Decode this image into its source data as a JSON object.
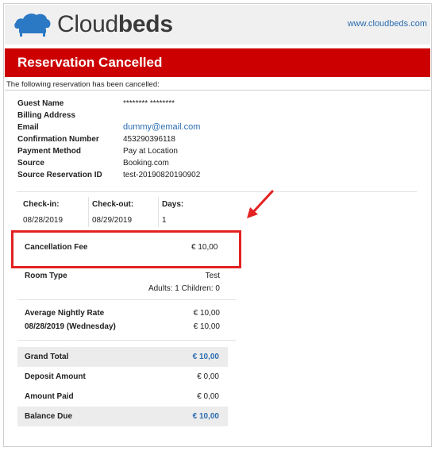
{
  "header": {
    "logo_light": "Cloud",
    "logo_bold": "beds",
    "site_link": "www.cloudbeds.com"
  },
  "banner": {
    "title": "Reservation Cancelled"
  },
  "intro": "The following reservation has been cancelled:",
  "guest_info": [
    {
      "label": "Guest Name",
      "value": "******** ********"
    },
    {
      "label": "Billing Address",
      "value": ""
    },
    {
      "label": "Email",
      "value": "dummy@email.com"
    },
    {
      "label": "Confirmation Number",
      "value": "453290396118"
    },
    {
      "label": "Payment Method",
      "value": "Pay at Location"
    },
    {
      "label": "Source",
      "value": "Booking.com"
    },
    {
      "label": "Source Reservation ID",
      "value": "test-20190820190902"
    }
  ],
  "stay": {
    "checkin_label": "Check-in:",
    "checkin_value": "08/28/2019",
    "checkout_label": "Check-out:",
    "checkout_value": "08/29/2019",
    "days_label": "Days:",
    "days_value": "1"
  },
  "cancellation": {
    "label": "Cancellation Fee",
    "amount": "€ 10,00"
  },
  "room": {
    "label": "Room Type",
    "value": "Test",
    "occupancy": "Adults: 1 Children: 0"
  },
  "rates": {
    "avg_label": "Average Nightly Rate",
    "avg_value": "€ 10,00",
    "night_label": "08/28/2019 (Wednesday)",
    "night_value": "€ 10,00"
  },
  "totals": {
    "grand_total_label": "Grand Total",
    "grand_total_value": "€ 10,00",
    "deposit_label": "Deposit Amount",
    "deposit_value": "€ 0,00",
    "paid_label": "Amount Paid",
    "paid_value": "€ 0,00",
    "balance_label": "Balance Due",
    "balance_value": "€ 10,00"
  },
  "colors": {
    "banner": "#cc0000",
    "link": "#2b6cb0",
    "highlight": "#e32222",
    "logo_blue": "#2b78c5"
  }
}
